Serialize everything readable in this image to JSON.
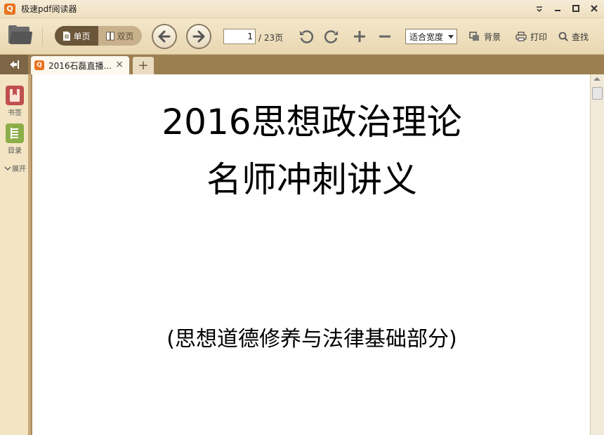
{
  "app": {
    "title": "极速pdf阅读器",
    "logo": "Q"
  },
  "window": {
    "minimize_icon": "minimize-icon",
    "maximize_icon": "maximize-icon",
    "close_icon": "close-icon"
  },
  "toolbar": {
    "single_page_label": "单页",
    "double_page_label": "双页",
    "current_page": "1",
    "total_pages": "/ 23页",
    "zoom_mode": "适合宽度",
    "background_label": "背景",
    "print_label": "打印",
    "find_label": "查找"
  },
  "tabs": [
    {
      "title": "2016石磊直播...",
      "close": "×"
    }
  ],
  "new_tab_label": "+",
  "leftpanel": {
    "bookmark_label": "书签",
    "toc_label": "目录",
    "expand_label": "展开"
  },
  "document": {
    "title_line1": "2016思想政治理论",
    "title_line2": "名师冲刺讲义",
    "subtitle": "(思想道德修养与法律基础部分)"
  },
  "colors": {
    "accent": "#e8741f",
    "frame": "#9c7f51",
    "toolbar": "#f3e7cb",
    "bookmark_icon": "#c0504d",
    "toc_icon": "#8cae48"
  }
}
